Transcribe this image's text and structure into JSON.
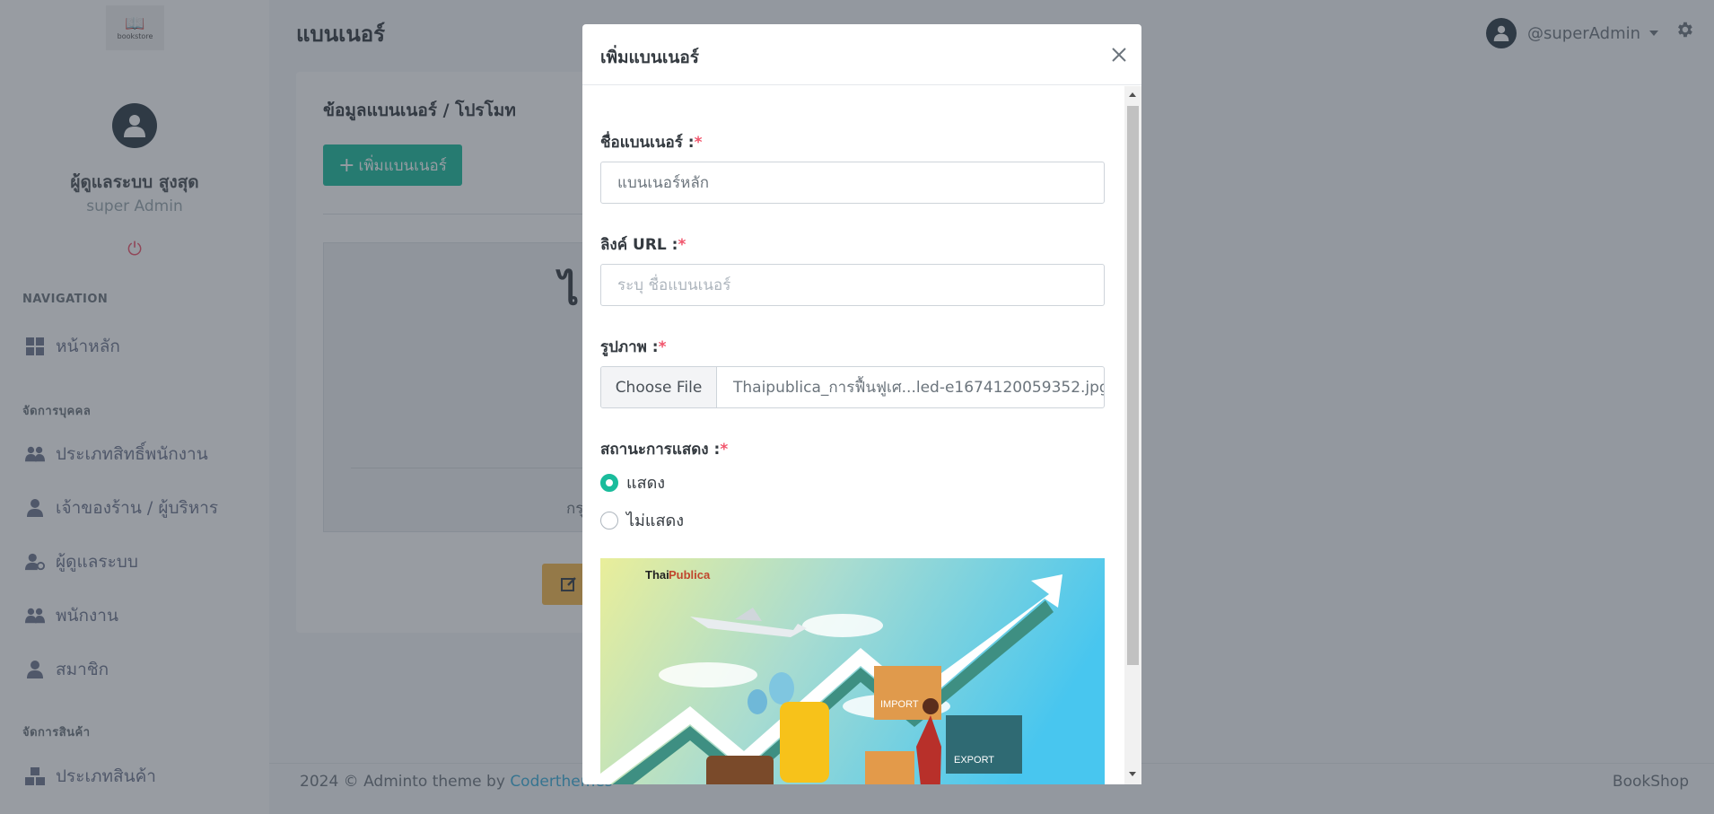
{
  "sidebar": {
    "logo_text": "bookstore",
    "user_name": "ผู้ดูแลระบบ สูงสุด",
    "user_role": "super Admin",
    "sections": [
      {
        "title": "NAVIGATION",
        "items": [
          {
            "label": "หน้าหลัก",
            "icon": "dashboard-icon"
          }
        ]
      },
      {
        "title": "จัดการบุคคล",
        "items": [
          {
            "label": "ประเภทสิทธิ์พนักงาน",
            "icon": "users-icon"
          },
          {
            "label": "เจ้าของร้าน / ผู้บริหาร",
            "icon": "user-icon"
          },
          {
            "label": "ผู้ดูแลระบบ",
            "icon": "user-cog-icon"
          },
          {
            "label": "พนักงาน",
            "icon": "users-icon"
          },
          {
            "label": "สมาชิก",
            "icon": "user-icon"
          }
        ]
      },
      {
        "title": "จัดการสินค้า",
        "items": [
          {
            "label": "ประเภทสินค้า",
            "icon": "boxes-icon"
          }
        ]
      }
    ]
  },
  "topbar": {
    "page_title": "แบนเนอร์",
    "username": "@superAdmin"
  },
  "card": {
    "title": "ข้อมูลแบนเนอร์ / โปรโมท",
    "add_button": "เพิ่มแบนเนอร์",
    "big_text": "ไ",
    "table_text": "กรุ"
  },
  "footer": {
    "left_text": "2024 © Adminto theme by",
    "left_link": "Coderthemes",
    "right_text": "BookShop"
  },
  "modal": {
    "title": "เพิ่มแบนเนอร์",
    "fields": {
      "name_label": "ชื่อแบนเนอร์ :",
      "name_value": "แบนเนอร์หลัก",
      "url_label": "ลิงค์ URL :",
      "url_placeholder": "ระบุ ชื่อแบนเนอร์",
      "image_label": "รูปภาพ :",
      "file_button": "Choose File",
      "file_name": "Thaipublica_การฟื้นฟูเศ...led-e1674120059352.jpg",
      "status_label": "สถานะการแสดง :",
      "required_mark": "*"
    },
    "status_options": [
      {
        "label": "แสดง",
        "checked": true
      },
      {
        "label": "ไม่แสดง",
        "checked": false
      }
    ],
    "preview": {
      "brand_thai": "Thai",
      "brand_publica": "Publica",
      "import_label": "IMPORT",
      "export_label": "EXPORT"
    }
  },
  "colors": {
    "accent": "#1abc9c",
    "danger": "#f1556c",
    "warning": "#f7b84b",
    "link": "#3bafda"
  }
}
